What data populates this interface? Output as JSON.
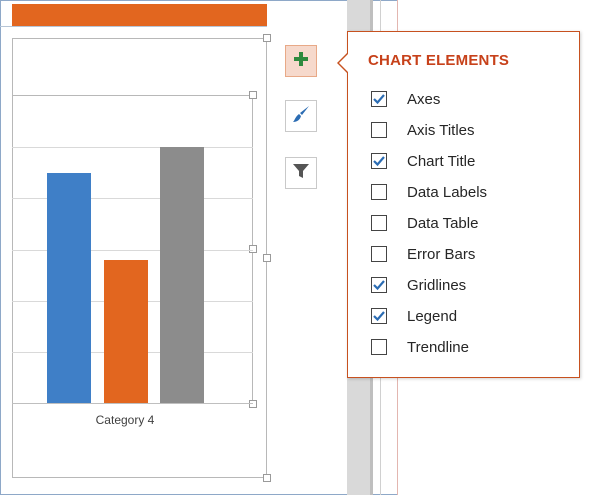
{
  "popup": {
    "title": "CHART ELEMENTS",
    "options": [
      {
        "label": "Axes",
        "checked": true
      },
      {
        "label": "Axis Titles",
        "checked": false
      },
      {
        "label": "Chart Title",
        "checked": true
      },
      {
        "label": "Data Labels",
        "checked": false
      },
      {
        "label": "Data Table",
        "checked": false
      },
      {
        "label": "Error Bars",
        "checked": false
      },
      {
        "label": "Gridlines",
        "checked": true
      },
      {
        "label": "Legend",
        "checked": true
      },
      {
        "label": "Trendline",
        "checked": false
      }
    ]
  },
  "side_buttons": [
    {
      "icon": "plus-icon",
      "active": true
    },
    {
      "icon": "paintbrush-icon",
      "active": false
    },
    {
      "icon": "funnel-icon",
      "active": false
    }
  ],
  "chart": {
    "category_label": "Category 4",
    "series_colors": [
      "#3f7fc7",
      "#e2661f",
      "#8c8c8c"
    ]
  },
  "colors": {
    "accent": "#c7411a",
    "check": "#2b6cb3",
    "orange": "#e2661f"
  }
}
